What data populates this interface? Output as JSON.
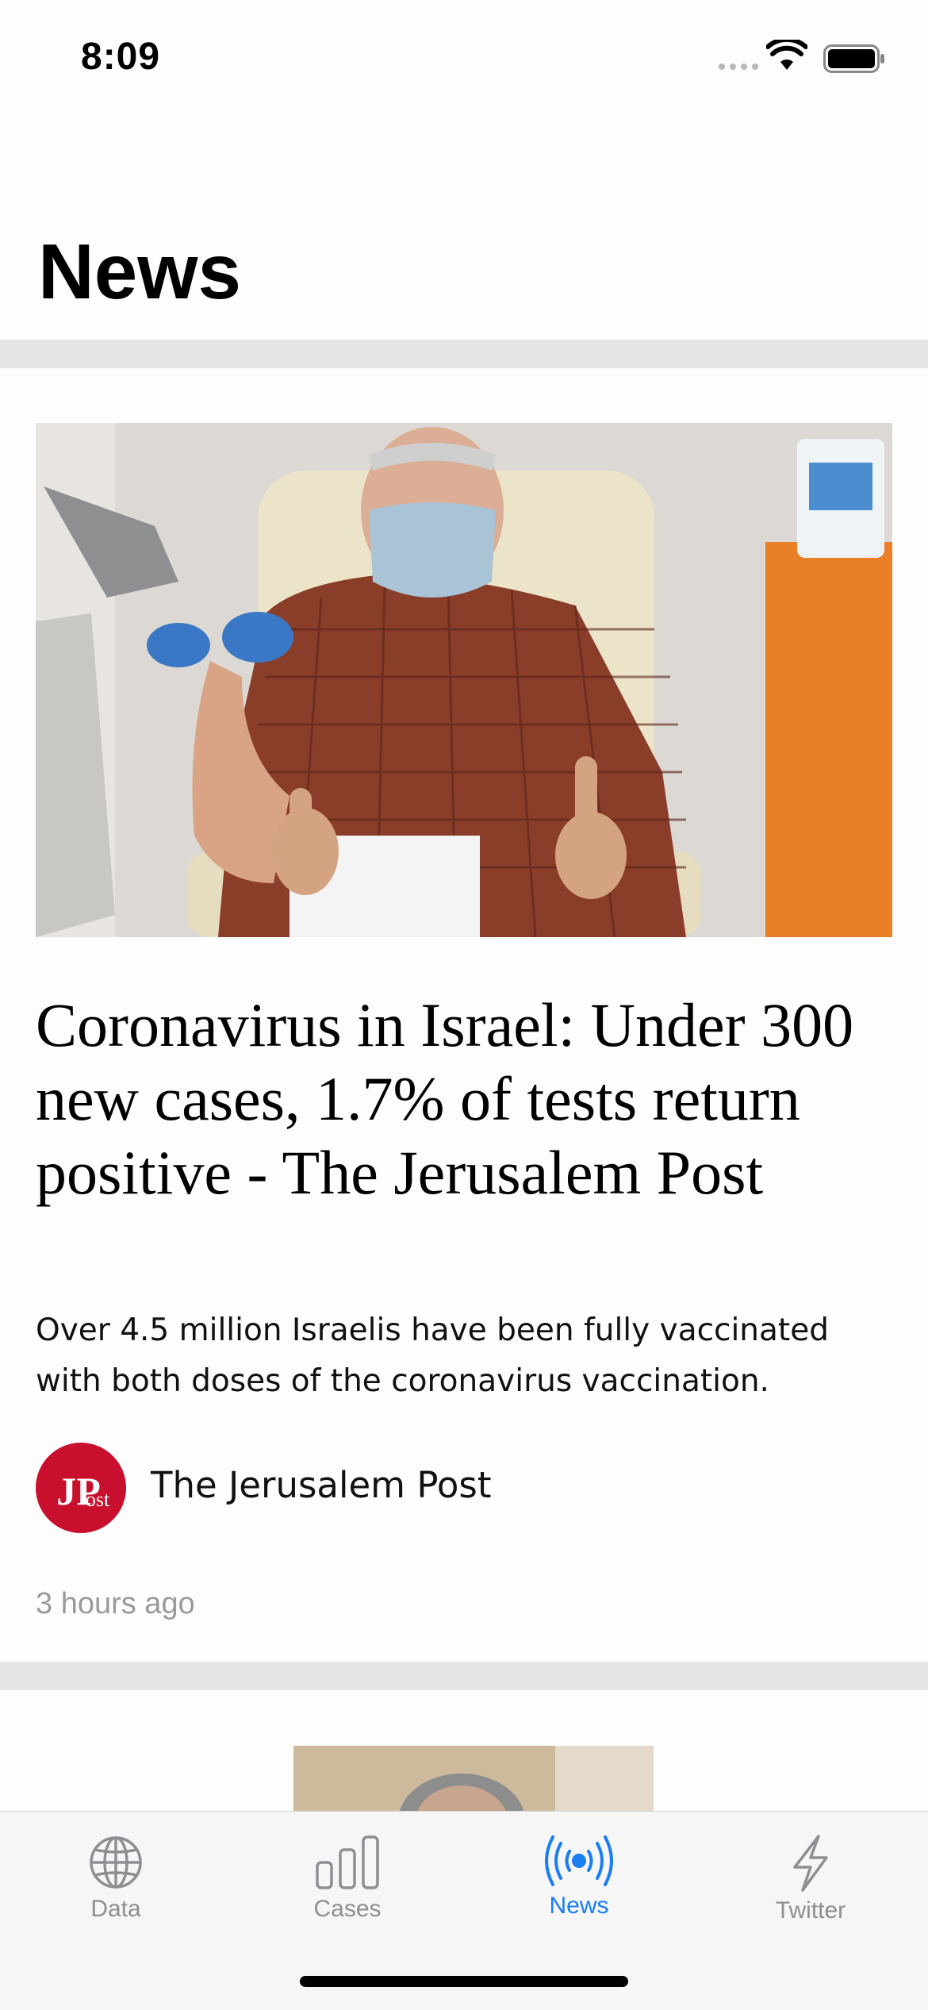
{
  "status_bar": {
    "time": "8:09",
    "icons": [
      "cellular-signal-icon",
      "wifi-icon",
      "battery-icon"
    ]
  },
  "header": {
    "title": "News"
  },
  "articles": [
    {
      "image": "photo of elderly man in checked shirt and face mask receiving a vaccine, giving two thumbs up",
      "headline": "Coronavirus in Israel: Under 300 new cases, 1.7% of tests return positive - The Jerusalem Post",
      "summary": "Over 4.5 million Israelis have been fully vaccinated with both doses of the coronavirus vaccination.",
      "source": {
        "name": "The Jerusalem Post",
        "logo_text": "JPost",
        "logo_color": "#c8102e"
      },
      "time_ago": "3 hours ago"
    },
    {
      "image": "photo of a person with grey hair (partially visible)"
    }
  ],
  "tab_bar": {
    "tabs": [
      {
        "label": "Data",
        "icon": "globe-icon",
        "active": false
      },
      {
        "label": "Cases",
        "icon": "bar-chart-icon",
        "active": false
      },
      {
        "label": "News",
        "icon": "broadcast-icon",
        "active": true
      },
      {
        "label": "Twitter",
        "icon": "lightning-icon",
        "active": false
      }
    ],
    "active_color": "#1a7df2",
    "inactive_color": "#8e8e93"
  }
}
